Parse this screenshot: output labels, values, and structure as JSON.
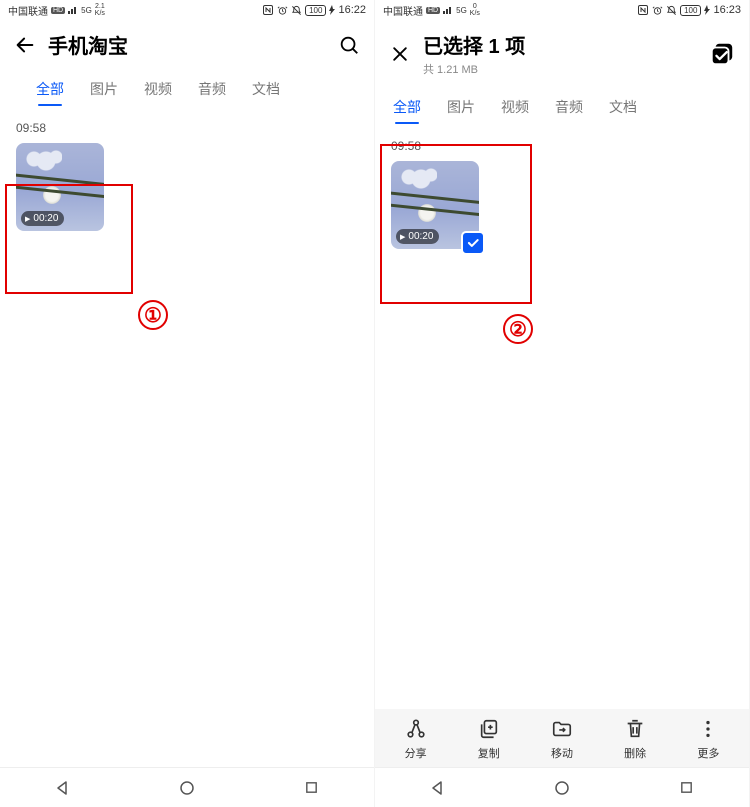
{
  "pane1": {
    "status": {
      "carrier": "中国联通",
      "hd": "HD",
      "sig": "5G",
      "net_top": "2.1",
      "net_bot": "K/s",
      "batt": "100",
      "time": "16:22"
    },
    "header": {
      "title": "手机淘宝"
    },
    "tabs": [
      "全部",
      "图片",
      "视频",
      "音频",
      "文档"
    ],
    "active_tab": 0,
    "group_time": "09:58",
    "video_duration": "00:20",
    "callout": "①"
  },
  "pane2": {
    "status": {
      "carrier": "中国联通",
      "hd": "HD",
      "sig": "5G",
      "net_top": "0",
      "net_bot": "K/s",
      "batt": "100",
      "time": "16:23"
    },
    "header": {
      "title": "已选择 1 项",
      "subtitle": "共 1.21 MB"
    },
    "tabs": [
      "全部",
      "图片",
      "视频",
      "音频",
      "文档"
    ],
    "active_tab": 0,
    "group_time": "09:58",
    "video_duration": "00:20",
    "callout": "②",
    "actions": {
      "share": "分享",
      "copy": "复制",
      "move": "移动",
      "delete": "删除",
      "more": "更多"
    }
  }
}
